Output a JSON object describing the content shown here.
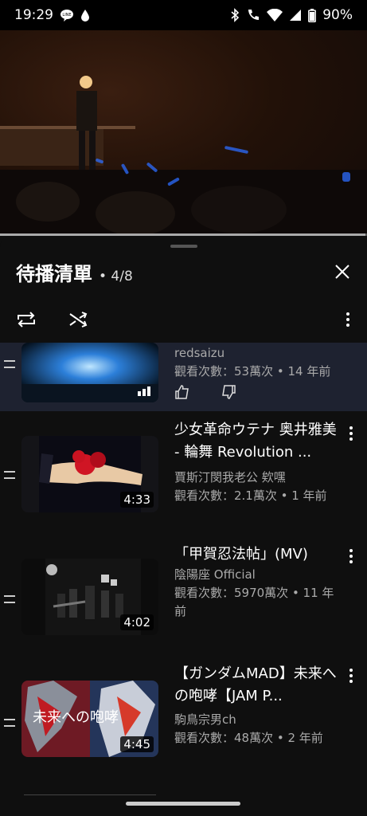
{
  "status": {
    "time": "19:29",
    "battery": "90%"
  },
  "player": {
    "progress_fraction": 0.995
  },
  "queue": {
    "title": "待播清單",
    "position": "• 4/8",
    "items": [
      {
        "channel": "redsaizu",
        "meta": "觀看次數：53萬次 • 14 年前"
      },
      {
        "title": "少女革命ウテナ 奥井雅美 - 輪舞 Revolution ...",
        "channel": "賈斯汀閔我老公 欸嘿",
        "meta": "觀看次數：2.1萬次 • 1 年前",
        "duration": "4:33"
      },
      {
        "title": "「甲賀忍法帖」(MV)",
        "channel": "陰陽座 Official",
        "meta": "觀看次數：5970萬次 • 11 年前",
        "duration": "4:02"
      },
      {
        "title": "【ガンダムMAD】未来への咆哮【JAM P...",
        "channel": "駒鳥宗男ch",
        "meta": "觀看次數：48萬次 • 2 年前",
        "duration": "4:45",
        "thumb_text": "未来への咆哮"
      }
    ]
  },
  "colors": {
    "background": "#0f0f0f",
    "current_row": "#1e2230",
    "accent": "#2c6cff"
  }
}
